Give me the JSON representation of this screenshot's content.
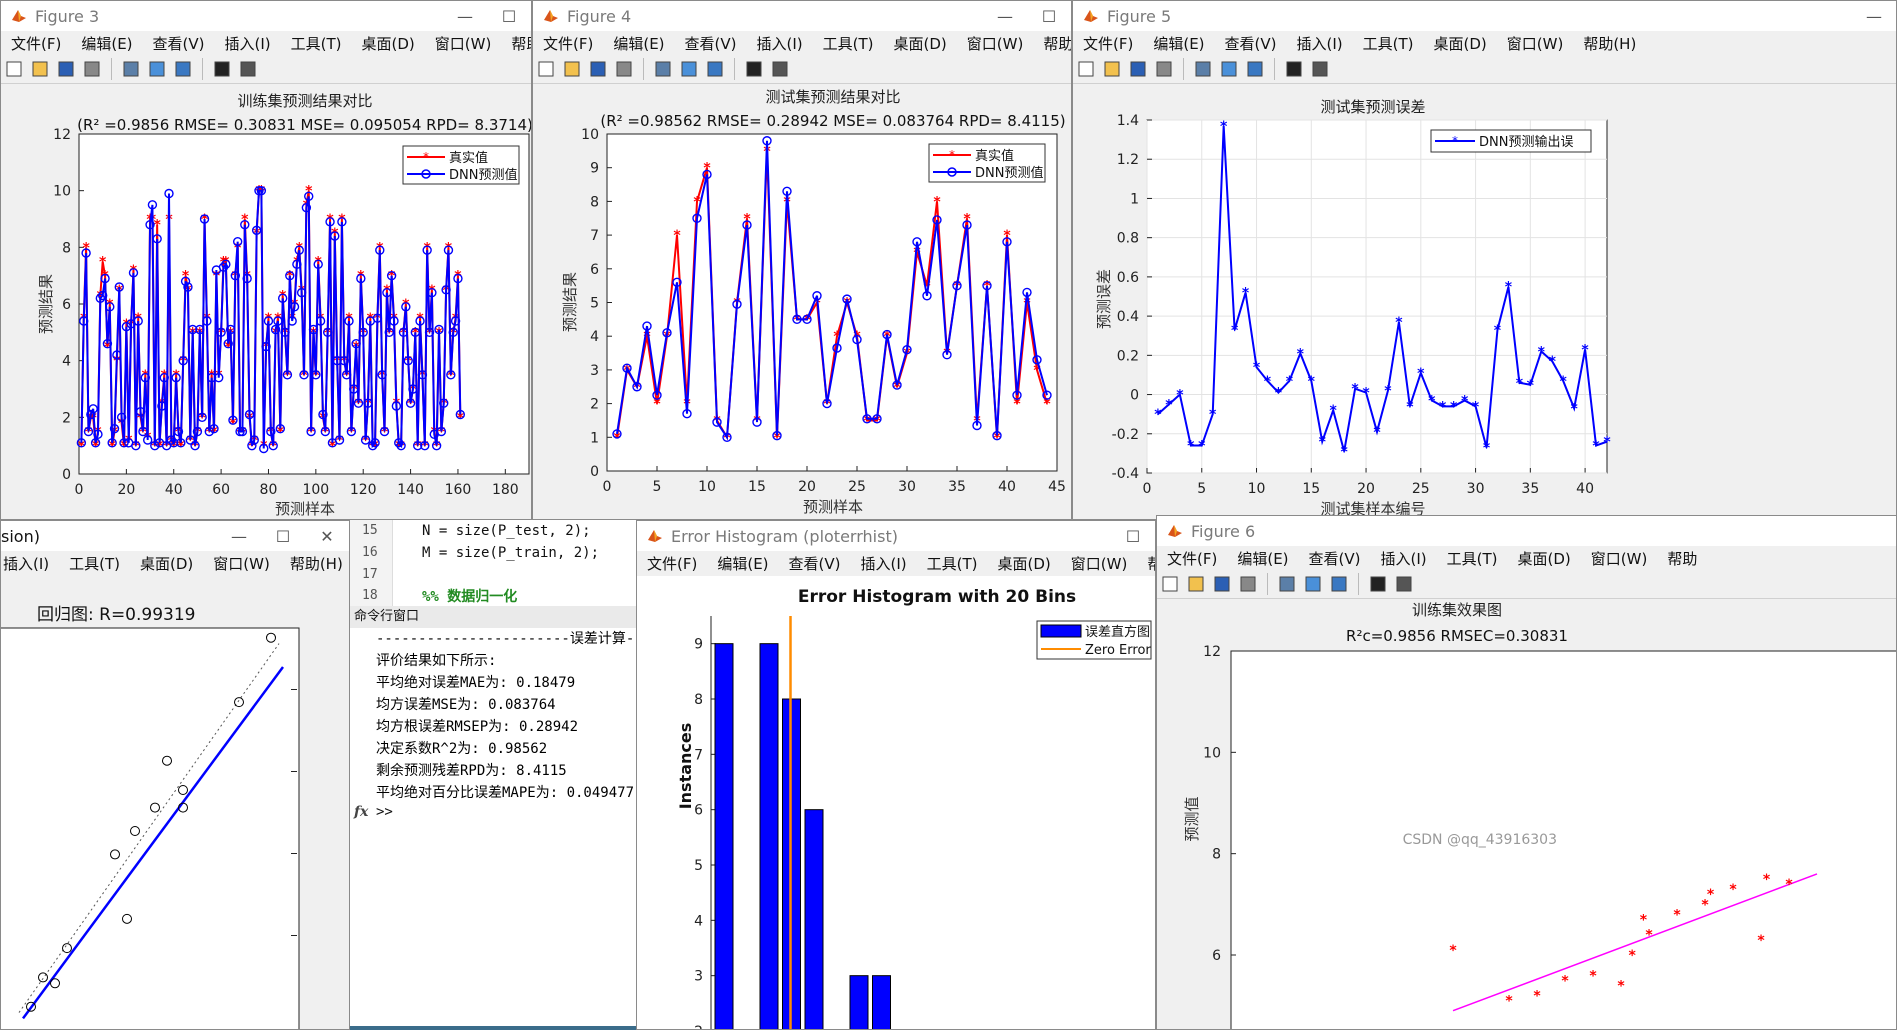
{
  "menu": [
    "文件(F)",
    "编辑(E)",
    "查看(V)",
    "插入(I)",
    "工具(T)",
    "桌面(D)",
    "窗口(W)",
    "帮助(H)"
  ],
  "toolbar_icons": [
    "new-file-icon",
    "open-folder-icon",
    "save-icon",
    "print-icon",
    "link-icon",
    "colorbar-icon",
    "legend-icon",
    "pointer-icon",
    "property-editor-icon"
  ],
  "fig3": {
    "window_title": "Figure 3",
    "title_line1": "训练集预测结果对比",
    "title_line2": "(R² =0.9856 RMSE= 0.30831 MSE= 0.095054 RPD= 8.3714)",
    "xlabel": "预测样本",
    "ylabel": "预测结果",
    "legend": [
      "真实值",
      "DNN预测值"
    ]
  },
  "fig4": {
    "window_title": "Figure 4",
    "title_line1": "测试集预测结果对比",
    "title_line2": "(R² =0.98562 RMSE= 0.28942 MSE= 0.083764 RPD= 8.4115)",
    "xlabel": "预测样本",
    "ylabel": "预测结果",
    "legend": [
      "真实值",
      "DNN预测值"
    ]
  },
  "fig5": {
    "window_title": "Figure 5",
    "title": "测试集预测误差",
    "xlabel": "测试集样本编号",
    "ylabel": "预测误差",
    "legend": [
      "DNN预测输出误"
    ]
  },
  "regwin": {
    "window_title": "sion)",
    "menu": [
      "插入(I)",
      "工具(T)",
      "桌面(D)",
      "窗口(W)",
      "帮助(H)"
    ],
    "title": "回归图: R=0.99319"
  },
  "editor": {
    "lines": [
      {
        "num": "15",
        "text": "N = size(P_test, 2);"
      },
      {
        "num": "16",
        "text": "M = size(P_train, 2);"
      },
      {
        "num": "17",
        "text": ""
      },
      {
        "num": "18",
        "text": "%%  数据归一化"
      }
    ],
    "cmd_title": "命令行窗口",
    "output": [
      "-----------------------误差计算----",
      "评价结果如下所示:",
      "平均绝对误差MAE为: 0.18479",
      "均方误差MSE为:        0.083764",
      "均方根误差RMSEP为:  0.28942",
      "决定系数R^2为:   0.98562",
      "剩余预测残差RPD为:    8.4115",
      "平均绝对百分比误差MAPE为:   0.049477"
    ],
    "prompt": ">>",
    "fx": "fx"
  },
  "errhist": {
    "window_title": "Error Histogram (ploterrhist)",
    "title": "Error Histogram with 20 Bins",
    "ylabel": "Instances",
    "legend": [
      "误差直方图",
      "Zero Error"
    ]
  },
  "fig6": {
    "window_title": "Figure 6",
    "menu": [
      "文件(F)",
      "编辑(E)",
      "查看(V)",
      "插入(I)",
      "工具(T)",
      "桌面(D)",
      "窗口(W)",
      "帮助"
    ],
    "title": "训练集效果图",
    "subtitle": "R²c=0.9856  RMSEC=0.30831",
    "ylabel": "预测值"
  },
  "watermark": "CSDN @qq_43916303",
  "chart_data": [
    {
      "type": "line",
      "title": "训练集预测结果对比",
      "subtitle": "(R² =0.9856 RMSE= 0.30831 MSE= 0.095054 RPD= 8.3714)",
      "xlabel": "预测样本",
      "ylabel": "预测结果",
      "xlim": [
        0,
        190
      ],
      "ylim": [
        0,
        12
      ],
      "xticks": [
        0,
        20,
        40,
        60,
        80,
        100,
        120,
        140,
        160,
        180
      ],
      "yticks": [
        0,
        2,
        4,
        6,
        8,
        10,
        12
      ],
      "legend_position": "top-right",
      "series": [
        {
          "name": "真实值",
          "color": "#ff0000",
          "marker": "*",
          "values": [
            1,
            5.5,
            8,
            1.5,
            2,
            2,
            1,
            1.5,
            6.3,
            7.5,
            7,
            4.5,
            6,
            1,
            1.5,
            4,
            6.5,
            1.8,
            1,
            5.3,
            1.2,
            5.3,
            7.2,
            1,
            5.5,
            2,
            1.5,
            3.5,
            1.3,
            9,
            9,
            1,
            8.8,
            1,
            2.5,
            3.5,
            1,
            9,
            1.2,
            1,
            3.5,
            1.5,
            1,
            4,
            7,
            6.5,
            1.2,
            5,
            1,
            1.5,
            5,
            2,
            9,
            5.5,
            1.5,
            3.5,
            1.5,
            7,
            3.5,
            5,
            7.5,
            7.5,
            4.5,
            5,
            1.8,
            7,
            8,
            1.5,
            1.5,
            9,
            7,
            2,
            1,
            1.2,
            8.5,
            10,
            10,
            1,
            4.5,
            5.5,
            1.5,
            1,
            5,
            5.5,
            1.5,
            6.3,
            5,
            3.5,
            7,
            5.5,
            6,
            7.5,
            8,
            6.5,
            3.5,
            9.5,
            10,
            1.5,
            5,
            3.5,
            7.5,
            5.5,
            2,
            1.5,
            5,
            9,
            1,
            8.5,
            4,
            1.2,
            9,
            4,
            3.5,
            5.5,
            1.5,
            3,
            4.5,
            2.5,
            7,
            5,
            1.2,
            2.5,
            5.5,
            1,
            1,
            5.5,
            8,
            3.5,
            1.5,
            6.5,
            5,
            7,
            5.5,
            2.5,
            1,
            1,
            5,
            6,
            4,
            2.5,
            3,
            5,
            1,
            5.5,
            3.5,
            1,
            8,
            5,
            6.5,
            1.5,
            1,
            5,
            1.5,
            2.5,
            6.5,
            8,
            3.5,
            5,
            5.5,
            7,
            2
          ]
        },
        {
          "name": "DNN预测值",
          "color": "#0000ff",
          "marker": "o",
          "values": [
            1.1,
            5.4,
            7.8,
            1.5,
            2.1,
            2.3,
            1.1,
            1.4,
            6.2,
            6.3,
            6.9,
            4.6,
            5.9,
            1.1,
            1.6,
            4.2,
            6.6,
            2,
            1.1,
            5.2,
            1.1,
            5.3,
            7.1,
            1,
            5.4,
            2.2,
            1.5,
            3.4,
            1.2,
            8.8,
            9.5,
            1,
            8.3,
            1.1,
            2.4,
            3.4,
            1,
            9.9,
            1.2,
            1.1,
            3.4,
            1.5,
            1.1,
            4,
            6.8,
            6.6,
            1.2,
            5.1,
            1,
            1.5,
            5.1,
            2,
            9,
            5.4,
            1.5,
            3.4,
            1.6,
            7.2,
            3.4,
            5,
            7.3,
            7.4,
            4.6,
            5.1,
            1.9,
            7,
            8.2,
            1.5,
            1.5,
            8.8,
            6.9,
            2.1,
            1,
            1.2,
            8.6,
            10,
            10,
            0.9,
            4.5,
            5.4,
            1.5,
            1,
            5.1,
            5.4,
            1.6,
            6.2,
            5,
            3.5,
            7,
            5.4,
            5.9,
            7.4,
            7.9,
            6.4,
            3.5,
            9.4,
            9.8,
            1.5,
            5.1,
            3.5,
            7.4,
            5.4,
            2.1,
            1.5,
            5,
            8.9,
            1.1,
            8.4,
            4,
            1.2,
            8.9,
            4,
            3.5,
            5.4,
            1.5,
            3,
            4.6,
            2.5,
            6.9,
            5,
            1.2,
            2.5,
            5.4,
            1,
            1.1,
            5.5,
            7.9,
            3.5,
            1.5,
            6.4,
            5,
            7,
            5.4,
            2.4,
            1.1,
            1,
            5,
            5.9,
            4,
            2.5,
            3,
            5,
            1,
            5.4,
            3.5,
            1,
            7.9,
            5,
            6.4,
            1.4,
            1,
            5.1,
            1.5,
            2.5,
            6.5,
            7.9,
            3.5,
            5,
            5.4,
            6.9,
            2.1
          ]
        }
      ]
    },
    {
      "type": "line",
      "title": "测试集预测结果对比",
      "subtitle": "(R² =0.98562 RMSE= 0.28942 MSE= 0.083764 RPD= 8.4115)",
      "xlabel": "预测样本",
      "ylabel": "预测结果",
      "xlim": [
        0,
        45
      ],
      "ylim": [
        0,
        10
      ],
      "xticks": [
        0,
        5,
        10,
        15,
        20,
        25,
        30,
        35,
        40,
        45
      ],
      "yticks": [
        0,
        1,
        2,
        3,
        4,
        5,
        6,
        7,
        8,
        9,
        10
      ],
      "legend_position": "top-right",
      "series": [
        {
          "name": "真实值",
          "color": "#ff0000",
          "marker": "*",
          "values": [
            1,
            3,
            2.5,
            4,
            2,
            4,
            7,
            2,
            8,
            9,
            1.5,
            1,
            5,
            7.5,
            1.5,
            9.5,
            1,
            8,
            4.5,
            4.5,
            5,
            2,
            4,
            5,
            4,
            1.5,
            1.5,
            4,
            2.5,
            3.5,
            6.5,
            5.5,
            8,
            3.5,
            5.5,
            7.5,
            1.5,
            5.5,
            1,
            7,
            2,
            5,
            3,
            2
          ]
        },
        {
          "name": "DNN预测值",
          "color": "#0000ff",
          "marker": "o",
          "values": [
            1.1,
            3.05,
            2.5,
            4.3,
            2.25,
            4.1,
            5.6,
            1.7,
            7.5,
            8.8,
            1.45,
            1,
            4.95,
            7.3,
            1.45,
            9.8,
            1.05,
            8.3,
            4.5,
            4.5,
            5.2,
            2,
            3.65,
            5.1,
            3.9,
            1.55,
            1.55,
            4.05,
            2.55,
            3.6,
            6.8,
            5.2,
            7.45,
            3.45,
            5.5,
            7.3,
            1.35,
            5.5,
            1.05,
            6.8,
            2.25,
            5.3,
            3.3,
            2.25
          ]
        }
      ]
    },
    {
      "type": "line",
      "title": "测试集预测误差",
      "xlabel": "测试集样本编号",
      "ylabel": "预测误差",
      "xlim": [
        0,
        42
      ],
      "ylim": [
        -0.4,
        1.4
      ],
      "xticks": [
        0,
        5,
        10,
        15,
        20,
        25,
        30,
        35,
        40
      ],
      "yticks": [
        -0.4,
        -0.2,
        0,
        0.2,
        0.4,
        0.6,
        0.8,
        1,
        1.2,
        1.4
      ],
      "legend_position": "top-right",
      "series": [
        {
          "name": "DNN预测输出误",
          "color": "#0000ff",
          "marker": "*",
          "values": [
            -0.1,
            -0.05,
            0,
            -0.26,
            -0.26,
            -0.1,
            1.37,
            0.33,
            0.52,
            0.14,
            0.07,
            0.01,
            0.07,
            0.21,
            0.07,
            -0.24,
            -0.08,
            -0.29,
            0.03,
            0.01,
            -0.19,
            0.02,
            0.37,
            -0.06,
            0.11,
            -0.03,
            -0.06,
            -0.06,
            -0.03,
            -0.06,
            -0.27,
            0.33,
            0.55,
            0.06,
            0.05,
            0.22,
            0.17,
            0.07,
            -0.07,
            0.23,
            -0.26,
            -0.24
          ]
        }
      ]
    },
    {
      "type": "scatter",
      "title": "回归图: R=0.99319",
      "series": [
        {
          "name": "",
          "color": "#000000",
          "marker": "o",
          "points": [
            [
              1,
              1
            ],
            [
              1.3,
              1.5
            ],
            [
              1.6,
              1.4
            ],
            [
              1.9,
              2.0
            ],
            [
              3.1,
              3.6
            ],
            [
              3.4,
              2.5
            ],
            [
              3.6,
              4.0
            ],
            [
              4.1,
              4.4
            ],
            [
              4.8,
              4.7
            ],
            [
              4.4,
              5.2
            ],
            [
              4.8,
              4.4
            ],
            [
              6.2,
              6.2
            ],
            [
              7,
              7.3
            ]
          ]
        }
      ],
      "fit_line": {
        "color": "#0000ff"
      }
    },
    {
      "type": "bar",
      "title": "Error Histogram with 20 Bins",
      "ylabel": "Instances",
      "ylim": [
        2,
        9.5
      ],
      "yticks": [
        2,
        3,
        4,
        5,
        6,
        7,
        8,
        9
      ],
      "legend_position": "top-right",
      "series": [
        {
          "name": "误差直方图",
          "color": "#0000ff",
          "values": [
            9,
            0,
            9,
            8,
            6,
            2,
            3,
            3
          ]
        }
      ],
      "reference_line": {
        "name": "Zero Error",
        "color": "#ff8c00"
      }
    },
    {
      "type": "scatter",
      "title": "训练集效果图",
      "subtitle": "R²c=0.9856  RMSEC=0.30831",
      "ylabel": "预测值",
      "ylim": [
        4.5,
        12
      ],
      "yticks": [
        6,
        8,
        10,
        12
      ],
      "series": [
        {
          "name": "",
          "color": "#ff0000",
          "marker": "*",
          "points": [
            [
              1,
              6.1
            ],
            [
              2,
              5.1
            ],
            [
              2.5,
              5.2
            ],
            [
              3,
              5.5
            ],
            [
              3.5,
              5.6
            ],
            [
              4,
              5.4
            ],
            [
              4.2,
              6
            ],
            [
              4.4,
              6.7
            ],
            [
              4.5,
              6.4
            ],
            [
              5,
              6.8
            ],
            [
              5.5,
              7
            ],
            [
              5.6,
              7.2
            ],
            [
              6,
              7.3
            ],
            [
              6.5,
              6.3
            ],
            [
              6.6,
              7.5
            ],
            [
              7,
              7.4
            ]
          ]
        }
      ],
      "fit_line": {
        "color": "#ff00ff"
      }
    }
  ]
}
